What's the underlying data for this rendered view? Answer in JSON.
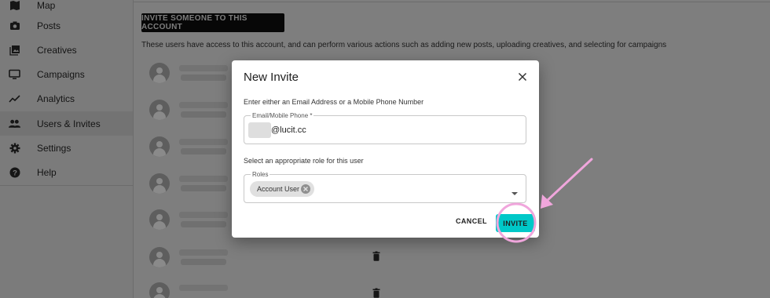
{
  "sidebar": {
    "items": [
      {
        "label": "Map",
        "icon": "map-icon"
      },
      {
        "label": "Posts",
        "icon": "camera-icon"
      },
      {
        "label": "Creatives",
        "icon": "image-library-icon"
      },
      {
        "label": "Campaigns",
        "icon": "monitor-icon"
      },
      {
        "label": "Analytics",
        "icon": "trending-line-icon"
      },
      {
        "label": "Users & Invites",
        "icon": "people-icon",
        "active": true
      },
      {
        "label": "Settings",
        "icon": "gear-icon"
      },
      {
        "label": "Help",
        "icon": "help-circle-icon"
      }
    ]
  },
  "main": {
    "invite_button": "INVITE SOMEONE TO THIS ACCOUNT",
    "description": "These users have access to this account, and can perform various actions such as adding new posts, uploading creatives, and selecting for campaigns"
  },
  "dialog": {
    "title": "New Invite",
    "prompt_contact": "Enter either an Email Address or a Mobile Phone Number",
    "email_label": "Email/Mobile Phone *",
    "email_value": "@lucit.cc",
    "prompt_role": "Select an appropriate role for this user",
    "roles_label": "Roles",
    "role_chip": "Account User",
    "cancel_label": "CANCEL",
    "submit_label": "INVITE"
  },
  "colors": {
    "accent": "#00c8c8",
    "annotation": "#f0a6dc"
  }
}
